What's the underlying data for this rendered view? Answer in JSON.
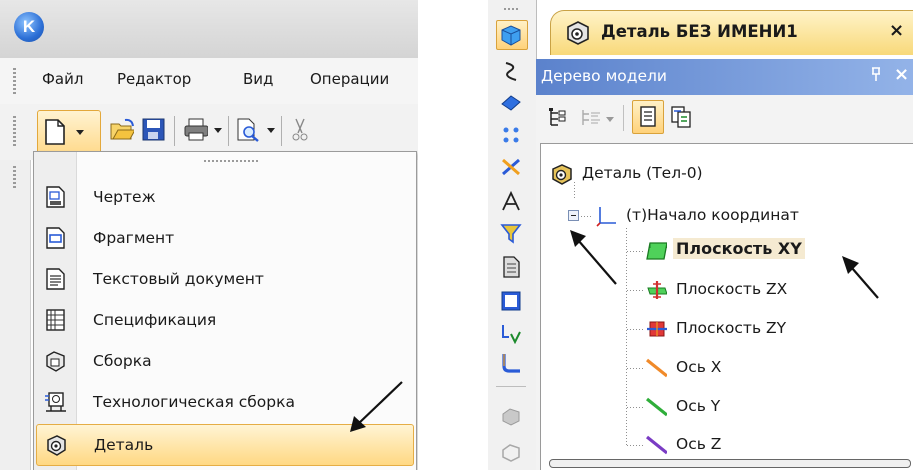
{
  "app": {
    "logo_letter": "K"
  },
  "menubar": {
    "items": [
      {
        "label": "Файл"
      },
      {
        "label": "Редактор"
      },
      {
        "label": "Вид"
      },
      {
        "label": "Операции"
      }
    ]
  },
  "new_menu": {
    "items": [
      {
        "label": "Чертеж",
        "icon": "drawing-icon"
      },
      {
        "label": "Фрагмент",
        "icon": "fragment-icon"
      },
      {
        "label": "Текстовый документ",
        "icon": "text-document-icon"
      },
      {
        "label": "Спецификация",
        "icon": "specification-icon"
      },
      {
        "label": "Сборка",
        "icon": "assembly-icon"
      },
      {
        "label": "Технологическая сборка",
        "icon": "technological-assembly-icon"
      },
      {
        "label": "Деталь",
        "icon": "part-icon",
        "selected": true
      }
    ]
  },
  "document_tab": {
    "title": "Деталь БЕЗ ИМЕНИ1",
    "close": "×"
  },
  "model_tree": {
    "title": "Дерево модели",
    "pin": "ꟼ",
    "close": "×",
    "nodes": [
      {
        "label": "Деталь (Тел-0)",
        "icon": "part-icon"
      },
      {
        "label": "(т)Начало координат",
        "icon": "origin-axes-icon",
        "expanded": true
      },
      {
        "label": "Плоскость XY",
        "icon": "plane-xy-icon",
        "selected": true
      },
      {
        "label": "Плоскость ZX",
        "icon": "plane-zx-icon"
      },
      {
        "label": "Плоскость ZY",
        "icon": "plane-zy-icon"
      },
      {
        "label": "Ось X",
        "icon": "axis-x-icon"
      },
      {
        "label": "Ось Y",
        "icon": "axis-y-icon"
      },
      {
        "label": "Ось Z",
        "icon": "axis-z-icon"
      }
    ]
  },
  "colors": {
    "selection_fill": "#ffd883",
    "selection_border": "#e5ad45",
    "tree_header": "#5b82cc",
    "annotation_arrow": "#111111"
  }
}
